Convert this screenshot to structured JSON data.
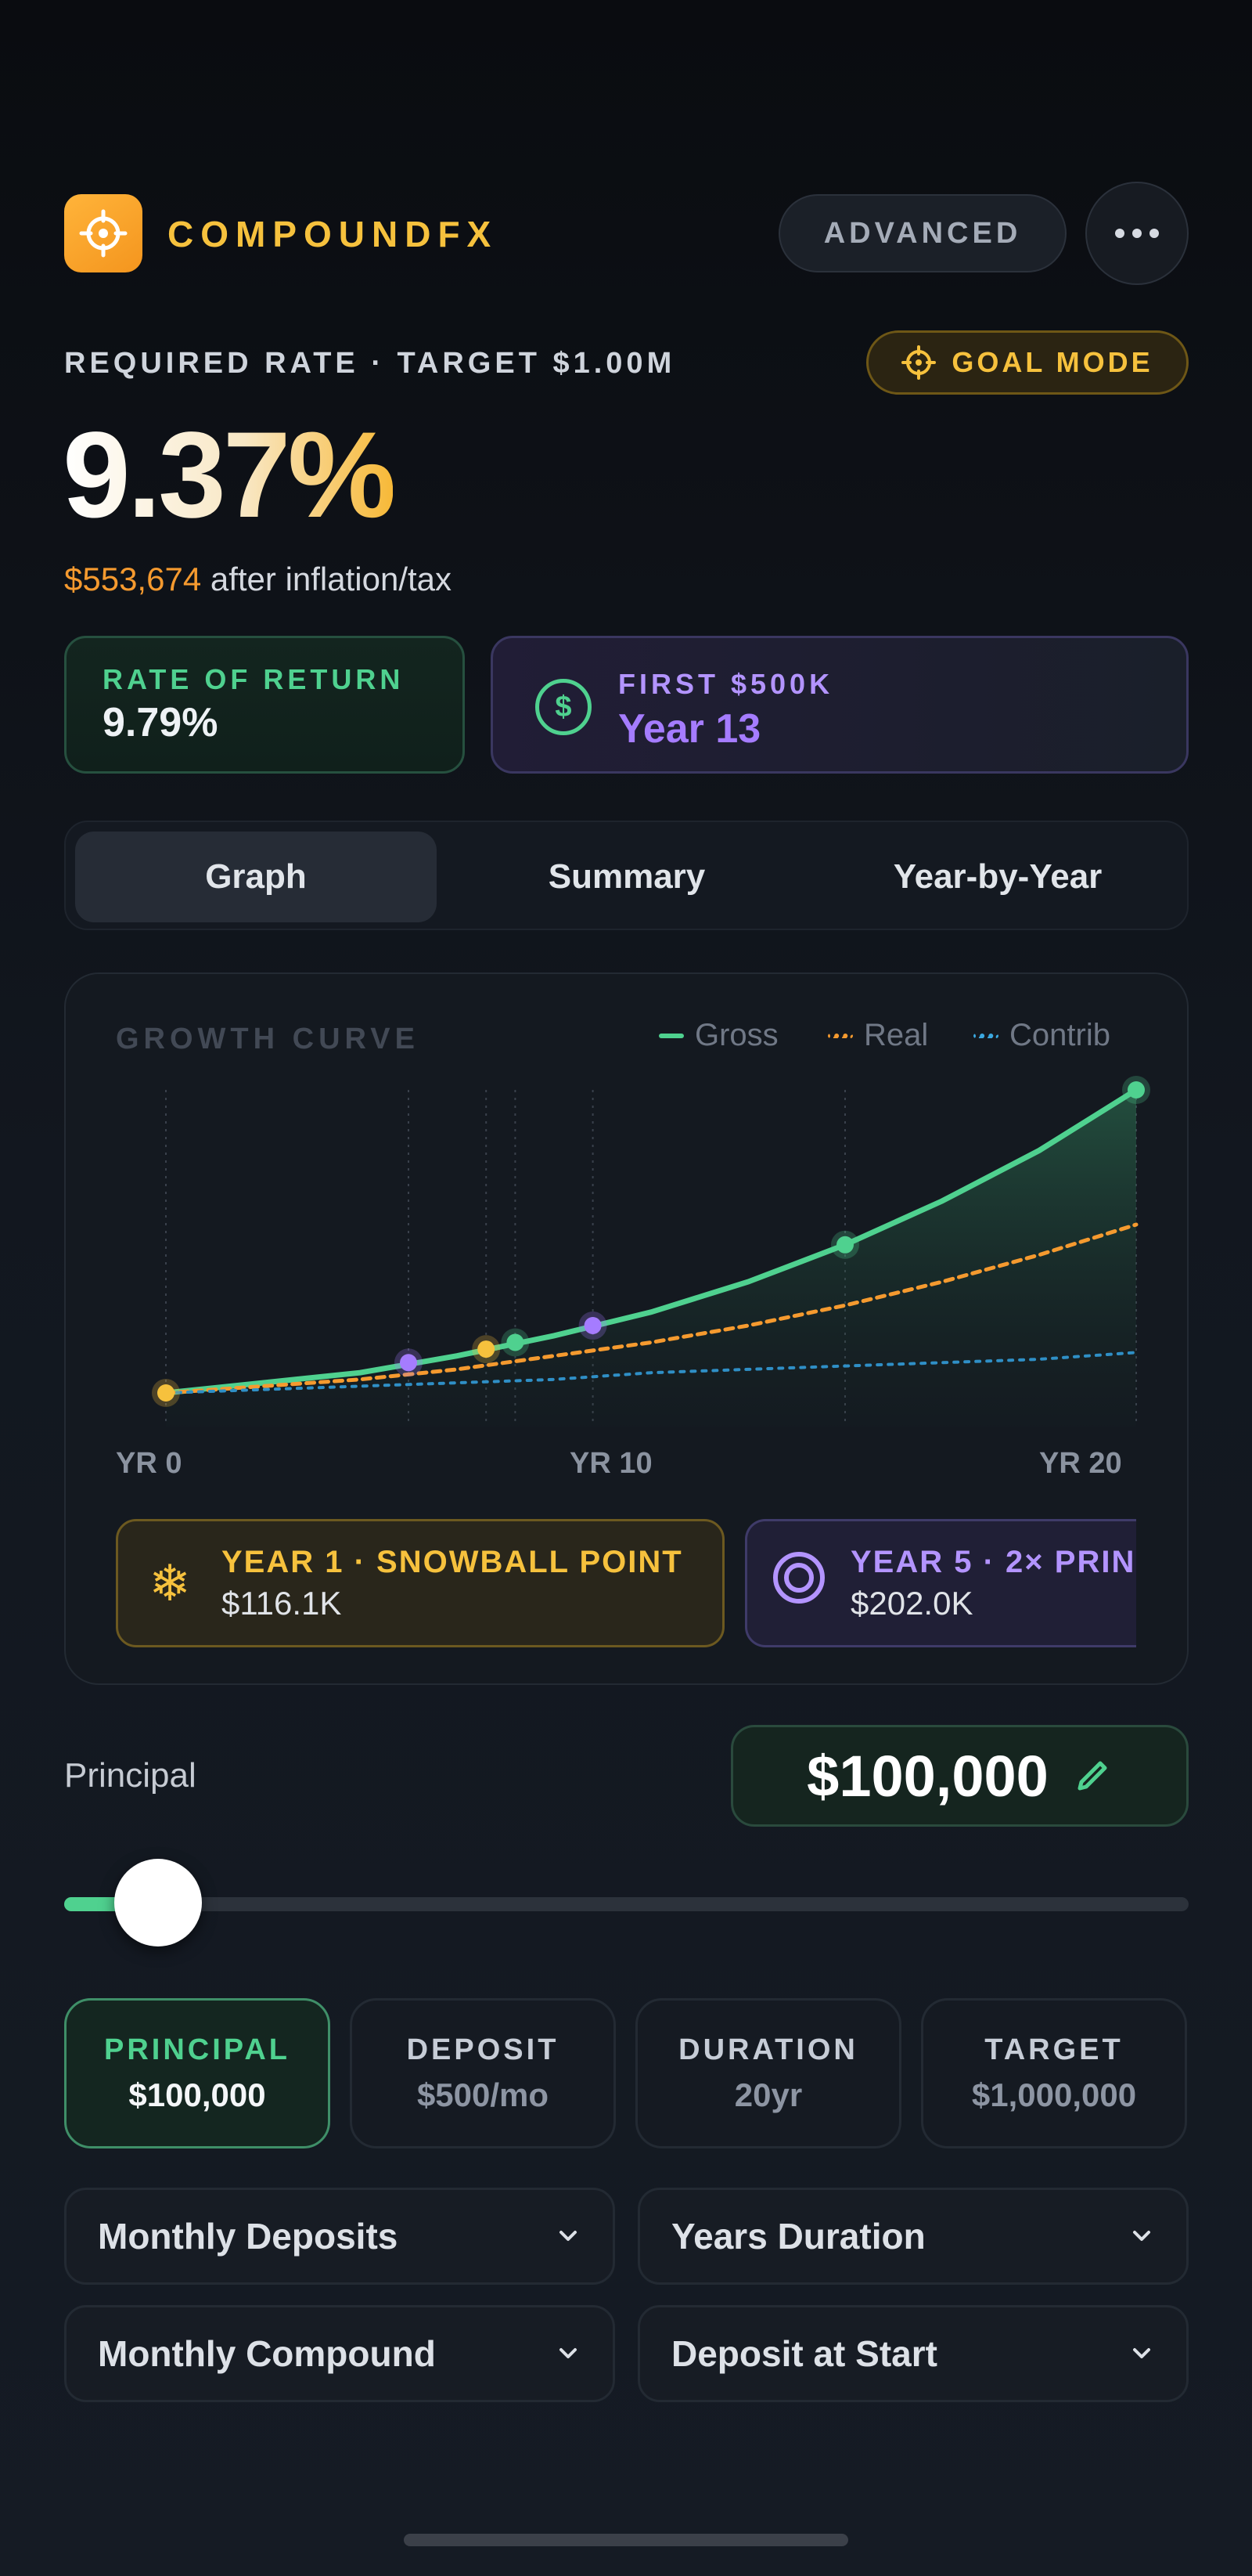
{
  "header": {
    "app_name": "COMPOUNDFX",
    "advanced_label": "ADVANCED"
  },
  "goal": {
    "required_label": "REQUIRED RATE · TARGET $1.00M",
    "mode_label": "GOAL MODE",
    "required_rate": "9.37%",
    "after_amount": "$553,674",
    "after_text": "after inflation/tax"
  },
  "stats": {
    "rate_of_return_label": "RATE OF RETURN",
    "rate_of_return_value": "9.79%",
    "first_label": "FIRST $500K",
    "first_value": "Year 13"
  },
  "tabs": [
    {
      "label": "Graph",
      "active": true
    },
    {
      "label": "Summary",
      "active": false
    },
    {
      "label": "Year-by-Year",
      "active": false
    }
  ],
  "chart": {
    "title": "GROWTH CURVE",
    "legend": [
      {
        "name": "Gross",
        "color": "#4fd18f"
      },
      {
        "name": "Real",
        "color": "#f59a2f"
      },
      {
        "name": "Contrib",
        "color": "#3ba8e0"
      }
    ],
    "x_labels": [
      "YR 0",
      "YR 10",
      "YR 20"
    ],
    "milestones": [
      {
        "title": "YEAR 1 · SNOWBALL POINT",
        "value": "$116.1K",
        "icon": "snowflake-icon",
        "color": "#f6c13d"
      },
      {
        "title": "YEAR 5 · 2× PRIN",
        "value": "$202.0K",
        "icon": "target-icon",
        "color": "#b394ff"
      }
    ]
  },
  "chart_data": {
    "type": "line",
    "title": "GROWTH CURVE",
    "x": [
      0,
      2,
      4,
      6,
      8,
      10,
      12,
      14,
      16,
      18,
      20
    ],
    "xlim": [
      0,
      20
    ],
    "ylim": [
      0,
      1.0
    ],
    "series": [
      {
        "name": "Gross",
        "values": [
          0.1,
          0.13,
          0.16,
          0.21,
          0.27,
          0.34,
          0.43,
          0.54,
          0.67,
          0.82,
          1.0
        ]
      },
      {
        "name": "Real",
        "values": [
          0.1,
          0.12,
          0.14,
          0.17,
          0.21,
          0.25,
          0.3,
          0.36,
          0.43,
          0.51,
          0.6
        ]
      },
      {
        "name": "Contrib",
        "values": [
          0.1,
          0.11,
          0.12,
          0.13,
          0.14,
          0.16,
          0.17,
          0.18,
          0.19,
          0.2,
          0.22
        ]
      }
    ],
    "markers": [
      {
        "x": 0,
        "y": 0.1,
        "color": "#f6c13d"
      },
      {
        "x": 5,
        "y": 0.19,
        "color": "#a57cff"
      },
      {
        "x": 6.6,
        "y": 0.23,
        "color": "#f6c13d"
      },
      {
        "x": 7.2,
        "y": 0.25,
        "color": "#4fd18f"
      },
      {
        "x": 8.8,
        "y": 0.3,
        "color": "#a57cff"
      },
      {
        "x": 14,
        "y": 0.54,
        "color": "#4fd18f"
      },
      {
        "x": 20,
        "y": 1.0,
        "color": "#4fd18f"
      }
    ],
    "xlabel": "",
    "ylabel": ""
  },
  "principal": {
    "label": "Principal",
    "value": "$100,000",
    "slider_fraction": 0.04
  },
  "chips": [
    {
      "label": "PRINCIPAL",
      "value": "$100,000",
      "active": true
    },
    {
      "label": "DEPOSIT",
      "value": "$500/mo",
      "active": false
    },
    {
      "label": "DURATION",
      "value": "20yr",
      "active": false
    },
    {
      "label": "TARGET",
      "value": "$1,000,000",
      "active": false
    }
  ],
  "dropdowns": [
    {
      "label": "Monthly Deposits"
    },
    {
      "label": "Years Duration"
    },
    {
      "label": "Monthly Compound"
    },
    {
      "label": "Deposit at Start"
    }
  ]
}
